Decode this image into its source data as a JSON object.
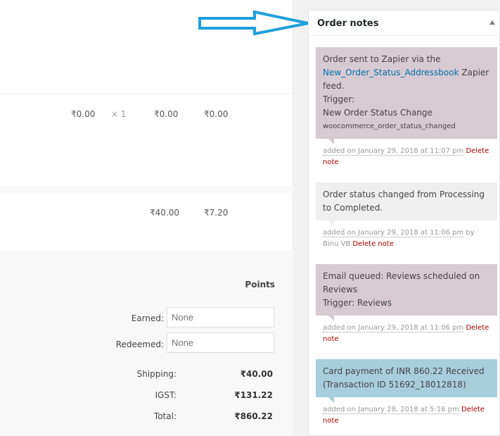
{
  "items": {
    "row1": {
      "cost": "₹0.00",
      "qty": "× 1",
      "total": "₹0.00",
      "tax": "₹0.00"
    },
    "row2": {
      "total": "₹40.00",
      "tax": "₹7.20"
    }
  },
  "points": {
    "heading": "Points",
    "earned_label": "Earned:",
    "earned_value": "None",
    "redeemed_label": "Redeemed:",
    "redeemed_value": "None"
  },
  "totals": {
    "shipping_label": "Shipping:",
    "shipping_value": "₹40.00",
    "igst_label": "IGST:",
    "igst_value": "₹131.22",
    "total_label": "Total:",
    "total_value": "₹860.22"
  },
  "order_notes": {
    "title": "Order notes",
    "notes": [
      {
        "line1": "Order sent to Zapier via the",
        "link": "New_Order_Status_Addressbook",
        "line2": " Zapier feed.",
        "line3": "Trigger:",
        "line4": "New Order Status Change",
        "line5": "woocommerce_order_status_changed",
        "date": "added on January 29, 2018 at 11:07 pm",
        "delete": "Delete note"
      },
      {
        "text": "Order status changed from Processing to Completed.",
        "date": "added on January 29, 2018 at 11:06 pm",
        "by": " by Binu VB",
        "delete": "Delete note"
      },
      {
        "line1": "Email queued: Reviews scheduled on Reviews",
        "line2": "Trigger: Reviews",
        "date": "added on January 29, 2018 at 11:06 pm",
        "delete": "Delete note"
      },
      {
        "text": "Card payment of INR 860.22 Received (Transaction ID 51692_18012818)",
        "date": "added on January 28, 2018 at 5:16 pm",
        "delete": "Delete note"
      }
    ]
  },
  "colors": {
    "arrow": "#1ea0db",
    "note_purple": "#d7cad2",
    "note_grey": "#efefef",
    "note_blue": "#a7cedc",
    "delete_link": "#aa0000"
  }
}
